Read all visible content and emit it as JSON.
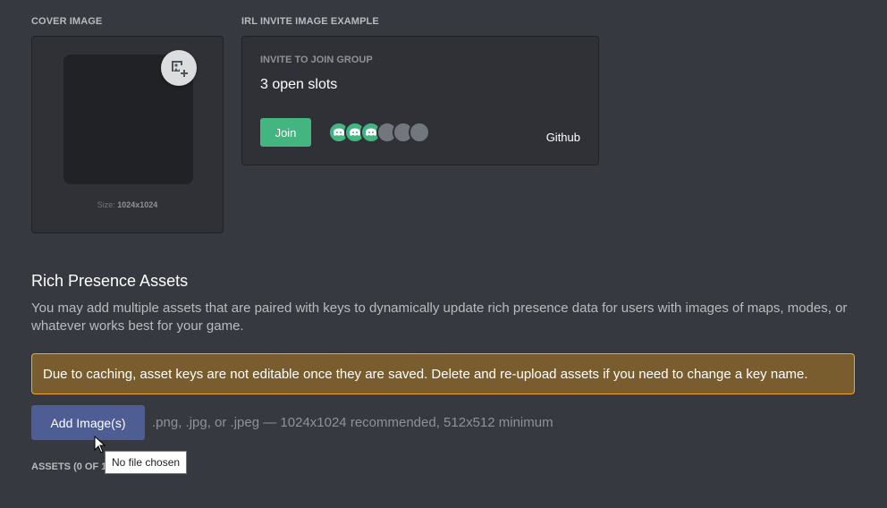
{
  "cover": {
    "label": "COVER IMAGE",
    "size_prefix": "Size:",
    "size_value": "1024x1024",
    "upload_icon": "add-image-icon"
  },
  "invite_example": {
    "label": "IRL INVITE IMAGE EXAMPLE",
    "heading": "INVITE TO JOIN GROUP",
    "slots": "3 open slots",
    "join_label": "Join",
    "app_name": "Github",
    "avatars_filled": 3,
    "avatars_empty": 3,
    "avatar_icon": "discord-logo-icon"
  },
  "rich_presence": {
    "title": "Rich Presence Assets",
    "description": "You may add multiple assets that are paired with keys to dynamically update rich presence data for users with images of maps, modes, or whatever works best for your game.",
    "warning": "Due to caching, asset keys are not editable once they are saved. Delete and re-upload assets if you need to change a key name.",
    "add_button": "Add Image(s)",
    "file_hint": ".png, .jpg, or .jpeg — 1024x1024 recommended, 512x512 minimum",
    "assets_label": "ASSETS (0 OF 1",
    "tooltip": "No file chosen"
  },
  "colors": {
    "background": "#36393f",
    "panel": "#2f3136",
    "join_green": "#43b581",
    "blurple_button": "#4e5d94",
    "warning_border": "#faa61a",
    "warning_bg": "#7a5d2e"
  }
}
